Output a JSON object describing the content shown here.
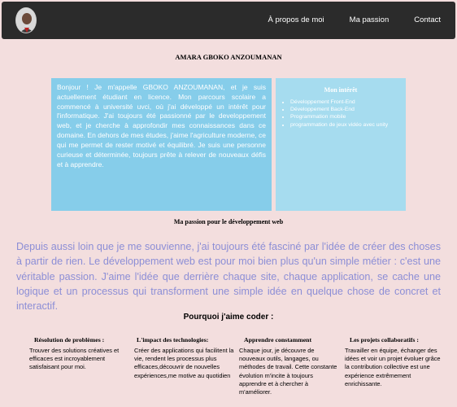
{
  "nav": {
    "links": [
      "À propos de moi",
      "Ma passion",
      "Contact"
    ]
  },
  "header": {
    "name": "AMARA GBOKO ANZOUMANAN"
  },
  "bio": {
    "text": "Bonjour ! Je m'appelle GBOKO ANZOUMANAN, et je suis actuellement étudiant en licence. Mon parcours scolaire a commencé à université uvci, où j'ai développé un intérêt pour l'informatique. J'ai toujours été passionné par le developpement web, et je cherche à approfondir mes connaissances dans ce domaine. En dehors de mes études, j'aime l'agriculture moderne, ce qui me permet de rester motivé et équilibré. Je suis une personne curieuse et déterminée, toujours prête à relever de nouveaux défis et à apprendre."
  },
  "interests": {
    "title": "Mon intérêt",
    "items": [
      "Développement Front-End",
      "Développement Back-End",
      "Programmation mobile",
      "programmation de jeux vidéo avec unity"
    ]
  },
  "passion": {
    "title": "Ma passion pour le développement web",
    "text": "Depuis aussi loin que je me souvienne, j'ai toujours été fasciné par l'idée de créer des choses à partir de rien. Le développement web est pour moi bien plus qu'un simple métier : c'est une véritable passion. J'aime l'idée que derrière chaque site, chaque application, se cache une logique et un processus qui transforment une simple idée en quelque chose de concret et interactif."
  },
  "why": {
    "title": "Pourquoi j'aime coder :",
    "cards": [
      {
        "title": "Résolution de problèmes :",
        "text": "Trouver des solutions créatives et efficaces est incroyablement satisfaisant pour moi."
      },
      {
        "title": "L'impact des technologies:",
        "text": "Créer des applications qui facilitent la vie, rendent les processus plus efficaces,découvrir de nouvelles expériences,me motive au quotidien"
      },
      {
        "title": "Apprendre constamment",
        "text": "Chaque jour, je découvre de nouveaux outils, langages, ou méthodes de travail. Cette constante évolution m'incite à toujours apprendre et à chercher à m'améliorer."
      },
      {
        "title": "Les projets collaboratifs :",
        "text": "Travailler en équipe, échanger des idées et voir un projet évoluer grâce à la contribution collective est une expérience extrêmement enrichissante."
      }
    ]
  }
}
